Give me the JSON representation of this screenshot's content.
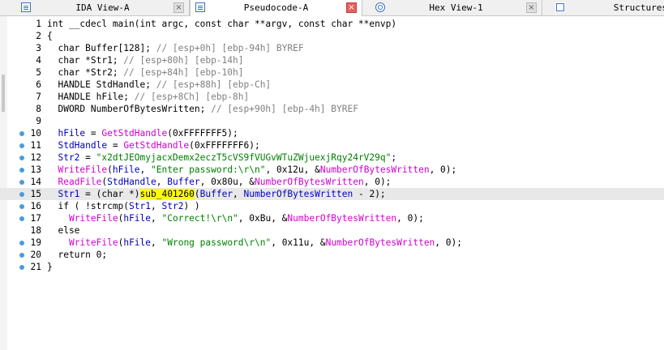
{
  "tabs": [
    {
      "label": "IDA View-A",
      "icon": "document-icon",
      "close": "×"
    },
    {
      "label": "Pseudocode-A",
      "icon": "document-icon",
      "close": "×",
      "active": true
    },
    {
      "label": "Hex View-1",
      "icon": "hex-icon",
      "close": "×"
    },
    {
      "label": "Structures",
      "icon": "structures-icon"
    }
  ],
  "code": {
    "l1": "int __cdecl main(int argc, const char **argv, const char **envp)",
    "l2": "{",
    "l3a": "  char Buffer[128]; ",
    "l3b": "// [esp+0h] [ebp-94h] BYREF",
    "l4a": "  char *Str1; ",
    "l4b": "// [esp+80h] [ebp-14h]",
    "l5a": "  char *Str2; ",
    "l5b": "// [esp+84h] [ebp-10h]",
    "l6a": "  HANDLE StdHandle; ",
    "l6b": "// [esp+88h] [ebp-Ch]",
    "l7a": "  HANDLE hFile; ",
    "l7b": "// [esp+8Ch] [ebp-8h]",
    "l8a": "  DWORD NumberOfBytesWritten; ",
    "l8b": "// [esp+90h] [ebp-4h] BYREF",
    "l10a": "  hFile",
    "l10b": " = ",
    "l10c": "GetStdHandle",
    "l10d": "(0xFFFFFFF5);",
    "l11a": "  StdHandle",
    "l11b": " = ",
    "l11c": "GetStdHandle",
    "l11d": "(0xFFFFFFF6);",
    "l12a": "  Str2",
    "l12b": " = ",
    "l12c": "\"x2dtJEOmyjacxDemx2eczT5cVS9fVUGvWTuZWjuexjRqy24rV29q\"",
    "l12d": ";",
    "l13a": "  ",
    "l13b": "WriteFile",
    "l13c": "(",
    "l13d": "hFile",
    "l13e": ", ",
    "l13f": "\"Enter password:\\r\\n\"",
    "l13g": ", 0x12u, &",
    "l13h": "NumberOfBytesWritten",
    "l13i": ", 0);",
    "l14a": "  ",
    "l14b": "ReadFile",
    "l14c": "(",
    "l14d": "StdHandle",
    "l14e": ", ",
    "l14f": "Buffer",
    "l14g": ", 0x80u, &",
    "l14h": "NumberOfBytesWritten",
    "l14i": ", 0);",
    "l15a": "  Str1",
    "l15b": " = (char *)",
    "l15c": "sub_401260",
    "l15d": "(",
    "l15e": "Buffer",
    "l15f": ", ",
    "l15g": "NumberOfBytesWritten",
    "l15h": " - 2);",
    "l16a": "  if ( !strcmp(",
    "l16b": "Str1",
    "l16c": ", ",
    "l16d": "Str2",
    "l16e": ") )",
    "l17a": "    ",
    "l17b": "WriteFile",
    "l17c": "(",
    "l17d": "hFile",
    "l17e": ", ",
    "l17f": "\"Correct!\\r\\n\"",
    "l17g": ", 0xBu, &",
    "l17h": "NumberOfBytesWritten",
    "l17i": ", 0);",
    "l18": "  else",
    "l19a": "    ",
    "l19b": "WriteFile",
    "l19c": "(",
    "l19d": "hFile",
    "l19e": ", ",
    "l19f": "\"Wrong password\\r\\n\"",
    "l19g": ", 0x11u, &",
    "l19h": "NumberOfBytesWritten",
    "l19i": ", 0);",
    "l20": "  return 0;",
    "l21": "}"
  },
  "line_numbers": [
    "1",
    "2",
    "3",
    "4",
    "5",
    "6",
    "7",
    "8",
    "9",
    "10",
    "11",
    "12",
    "13",
    "14",
    "15",
    "16",
    "17",
    "18",
    "19",
    "20",
    "21"
  ],
  "colors": {
    "function": "#d000d0",
    "string": "#008000",
    "variable": "#0000c0",
    "comment": "#808080",
    "highlight_line": "#e8e8e8",
    "selection": "#ffff00",
    "breakpoint_dot": "#4a9ae0"
  }
}
